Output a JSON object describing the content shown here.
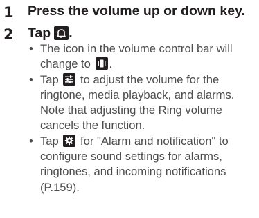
{
  "steps": [
    {
      "number": "1",
      "title": "Press the volume up or down key."
    },
    {
      "number": "2",
      "title_before": "Tap",
      "title_icon": "bell-off-icon",
      "title_after": ".",
      "bullets": [
        {
          "before": "The icon in the volume control bar will change to",
          "icon": "vibrate-icon",
          "after": "."
        },
        {
          "before": "Tap",
          "icon": "sliders-icon",
          "after": "to adjust the volume for the ringtone, media playback, and alarms. Note that adjusting the Ring volume cancels the function."
        },
        {
          "before": "Tap",
          "icon": "gear-icon",
          "after": "for \"Alarm and notification\" to configure sound settings for alarms, ringtones, and incoming notifications (P.159)."
        }
      ]
    }
  ],
  "colors": {
    "heading_text": "#231f20",
    "body_text": "#4d4d4f",
    "icon_background": "#231f20",
    "icon_foreground": "#ffffff"
  }
}
